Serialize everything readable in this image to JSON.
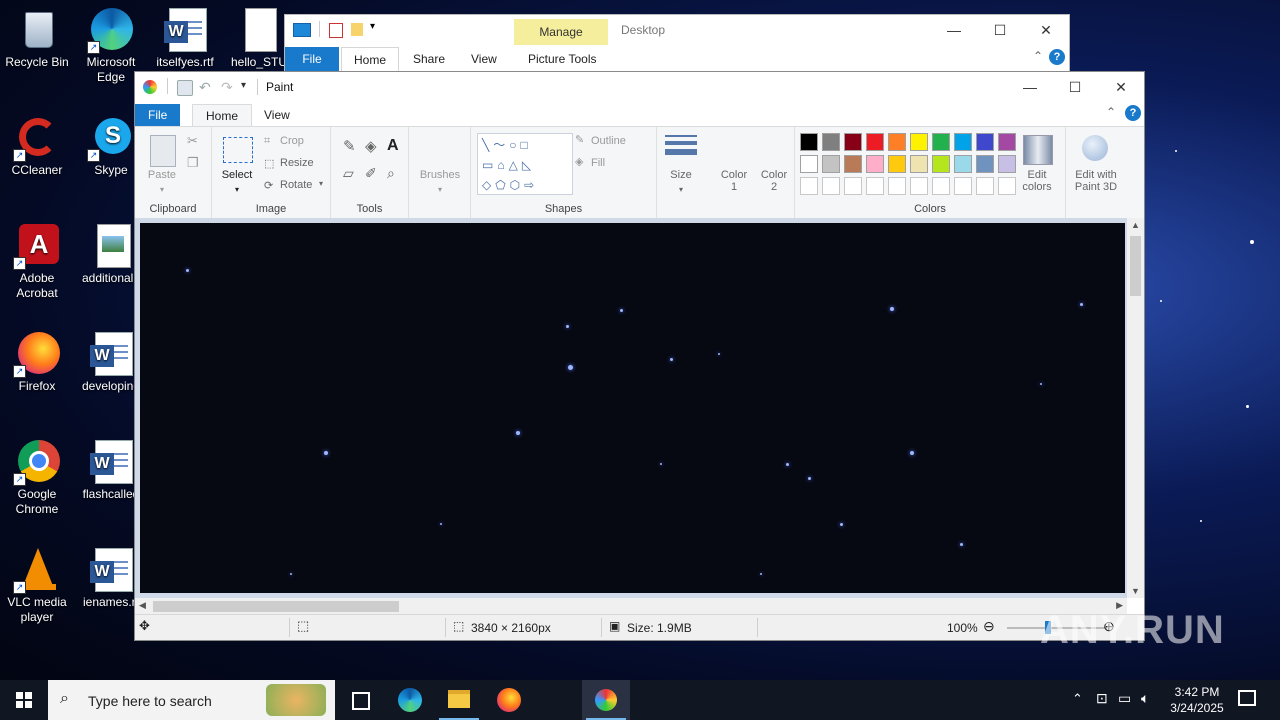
{
  "desktop": {
    "icons": [
      {
        "label": "Recycle Bin",
        "label2": ""
      },
      {
        "label": "Microsoft",
        "label2": "Edge"
      },
      {
        "label": "itselfyes.rtf",
        "label2": ""
      },
      {
        "label": "hello_STU",
        "label2": ""
      },
      {
        "label": "CCleaner",
        "label2": ""
      },
      {
        "label": "Skype",
        "label2": ""
      },
      {
        "label": "Adobe",
        "label2": "Acrobat"
      },
      {
        "label": "additionalb",
        "label2": ""
      },
      {
        "label": "Firefox",
        "label2": ""
      },
      {
        "label": "developing",
        "label2": ""
      },
      {
        "label": "Google",
        "label2": "Chrome"
      },
      {
        "label": "flashcalled",
        "label2": ""
      },
      {
        "label": "VLC media",
        "label2": "player"
      },
      {
        "label": "ienames.rt",
        "label2": ""
      }
    ]
  },
  "explorer": {
    "context_tab": "Manage",
    "location": "Desktop",
    "tabs": {
      "file": "File",
      "home": "Home",
      "share": "Share",
      "view": "View",
      "picture_tools": "Picture Tools"
    }
  },
  "paint": {
    "title": "Paint",
    "tabs": {
      "file": "File",
      "home": "Home",
      "view": "View"
    },
    "ribbon": {
      "clipboard": {
        "label": "Clipboard",
        "paste": "Paste"
      },
      "image": {
        "label": "Image",
        "select": "Select",
        "crop": "Crop",
        "resize": "Resize",
        "rotate": "Rotate"
      },
      "tools": {
        "label": "Tools"
      },
      "brushes": {
        "label": "Brushes"
      },
      "shapes": {
        "label": "Shapes",
        "outline": "Outline",
        "fill": "Fill"
      },
      "size": {
        "label": "Size"
      },
      "color1": {
        "line1": "Color",
        "line2": "1"
      },
      "color2": {
        "line1": "Color",
        "line2": "2"
      },
      "colors": {
        "label": "Colors",
        "row1": [
          "#000000",
          "#7f7f7f",
          "#880015",
          "#ed1c24",
          "#ff7f27",
          "#fff200",
          "#22b14c",
          "#00a2e8",
          "#3f48cc",
          "#a349a4"
        ],
        "row2": [
          "#ffffff",
          "#c3c3c3",
          "#b97a57",
          "#ffaec9",
          "#ffc90e",
          "#efe4b0",
          "#b5e61d",
          "#99d9ea",
          "#7092be",
          "#c8bfe7"
        ]
      },
      "edit_colors": {
        "line1": "Edit",
        "line2": "colors"
      },
      "paint3d": {
        "line1": "Edit with",
        "line2": "Paint 3D"
      }
    },
    "status": {
      "dimensions": "3840 × 2160px",
      "size": "Size: 1.9MB",
      "zoom": "100%"
    }
  },
  "taskbar": {
    "search_placeholder": "Type here to search",
    "time": "3:42 PM",
    "date": "3/24/2025"
  },
  "watermark": "ANY.RUN"
}
